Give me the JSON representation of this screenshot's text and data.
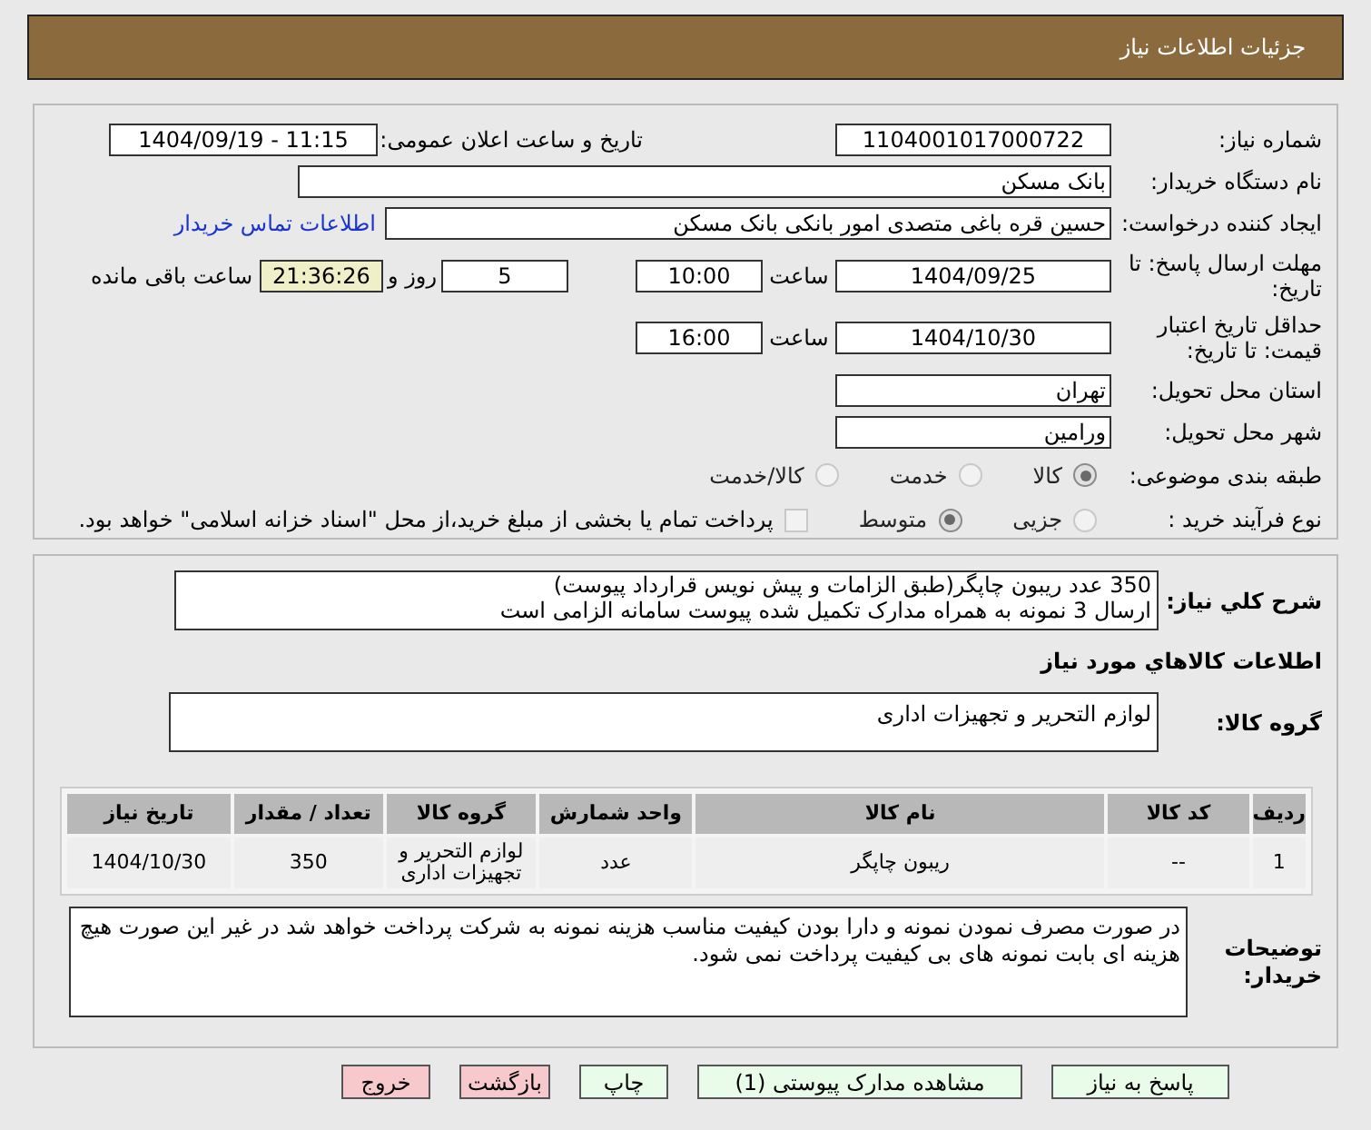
{
  "header": {
    "title": "جزئیات اطلاعات نیاز"
  },
  "need_number": {
    "label": "شماره نیاز:",
    "value": "1104001017000722"
  },
  "announce": {
    "label": "تاریخ و ساعت اعلان عمومی:",
    "value": "1404/09/19 - 11:15"
  },
  "buyer": {
    "label": "نام دستگاه خریدار:",
    "value": "بانک مسکن"
  },
  "creator": {
    "label": "ایجاد کننده درخواست:",
    "value": "حسین  قره باغی متصدی امور بانکی بانک مسکن",
    "link": "اطلاعات تماس خریدار"
  },
  "deadline": {
    "label": "مهلت ارسال پاسخ: تا تاریخ:",
    "date": "1404/09/25",
    "time_label": "ساعت",
    "time": "10:00",
    "days": "5",
    "days_label": "روز و",
    "remaining": "21:36:26",
    "remaining_label": "ساعت باقی مانده"
  },
  "validity": {
    "label": "حداقل تاریخ اعتبار قیمت: تا تاریخ:",
    "date": "1404/10/30",
    "time_label": "ساعت",
    "time": "16:00"
  },
  "province": {
    "label": "استان محل تحویل:",
    "value": "تهران"
  },
  "city": {
    "label": "شهر محل تحویل:",
    "value": "ورامین"
  },
  "category": {
    "label": "طبقه بندی موضوعی:",
    "options": [
      {
        "label": "کالا",
        "selected": true
      },
      {
        "label": "خدمت",
        "selected": false
      },
      {
        "label": "کالا/خدمت",
        "selected": false
      }
    ]
  },
  "process": {
    "label": "نوع فرآیند خرید :",
    "options": [
      {
        "label": "جزیی",
        "selected": false
      },
      {
        "label": "متوسط",
        "selected": true
      }
    ],
    "treasury": {
      "label": "پرداخت تمام یا بخشی از مبلغ خرید،از محل \"اسناد خزانه اسلامی\" خواهد بود.",
      "checked": false
    }
  },
  "description": {
    "label": "شرح کلي نیاز:",
    "lines": [
      "350 عدد ریبون چاپگر(طبق الزامات و پیش نویس قرارداد پیوست)",
      "ارسال 3 نمونه به همراه مدارک تکمیل شده پیوست سامانه الزامی است"
    ]
  },
  "goods_title": "اطلاعات کالاهاي مورد نیاز",
  "goods_group": {
    "label": "گروه کالا:",
    "value": "لوازم التحریر و تجهیزات اداری"
  },
  "table": {
    "columns": [
      "ردیف",
      "کد کالا",
      "نام کالا",
      "واحد شمارش",
      "گروه کالا",
      "تعداد / مقدار",
      "تاریخ نیاز"
    ],
    "rows": [
      [
        "1",
        "--",
        "ریبون چاپگر",
        "عدد",
        "لوازم التحریر و تجهیزات اداری",
        "350",
        "1404/10/30"
      ]
    ]
  },
  "notes": {
    "label": "توضیحات خریدار:",
    "value": "در صورت مصرف نمودن نمونه و دارا بودن کیفیت مناسب هزینه نمونه به شرکت پرداخت خواهد شد در غیر این صورت هیچ هزینه ای بابت نمونه های بی کیفیت پرداخت نمی شود."
  },
  "buttons": [
    {
      "label": "پاسخ به نیاز",
      "kind": "action"
    },
    {
      "label": "مشاهده مدارک پیوستی (1)",
      "kind": "action"
    },
    {
      "label": "چاپ",
      "kind": "action"
    },
    {
      "label": "بازگشت",
      "kind": "exit"
    },
    {
      "label": "خروج",
      "kind": "exit"
    }
  ]
}
